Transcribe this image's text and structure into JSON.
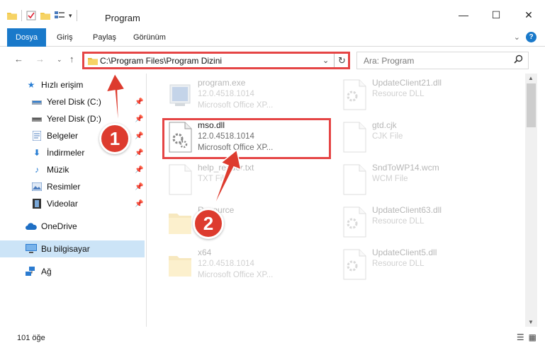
{
  "window": {
    "title": "Program"
  },
  "ribbon": {
    "tabs": [
      "Dosya",
      "Giriş",
      "Paylaş",
      "Görünüm"
    ],
    "help": "?"
  },
  "address": {
    "path": "C:\\Program Files\\Program Dizini"
  },
  "search": {
    "placeholder": "Ara: Program"
  },
  "sidebar": {
    "items": [
      {
        "label": "Hızlı erişim",
        "icon": "star-icon"
      },
      {
        "label": "Yerel Disk (C:)",
        "icon": "drive-icon"
      },
      {
        "label": "Yerel Disk (D:)",
        "icon": "drive-icon"
      },
      {
        "label": "Belgeler",
        "icon": "documents-icon"
      },
      {
        "label": "İndirmeler",
        "icon": "download-icon"
      },
      {
        "label": "Müzik",
        "icon": "music-icon"
      },
      {
        "label": "Resimler",
        "icon": "pictures-icon"
      },
      {
        "label": "Videolar",
        "icon": "video-icon"
      },
      {
        "label": "OneDrive",
        "icon": "cloud-icon"
      },
      {
        "label": "Bu bilgisayar",
        "icon": "computer-icon"
      },
      {
        "label": "Ağ",
        "icon": "network-icon"
      }
    ]
  },
  "files": [
    {
      "name": "program.exe",
      "line2": "12.0.4518.1014",
      "line3": "Microsoft Office XP..."
    },
    {
      "name": "mso.dll",
      "line2": "12.0.4518.1014",
      "line3": "Microsoft Office XP..."
    },
    {
      "name": "help_reader.txt",
      "line2": "TXT File",
      "line3": ""
    },
    {
      "name": "Resource",
      "line2": "",
      "line3": ""
    },
    {
      "name": "x64",
      "line2": "12.0.4518.1014",
      "line3": "Microsoft Office XP..."
    },
    {
      "name": "UpdateClient21.dll",
      "line2": "Resource DLL",
      "line3": ""
    },
    {
      "name": "gtd.cjk",
      "line2": "CJK File",
      "line3": ""
    },
    {
      "name": "SndToWP14.wcm",
      "line2": "WCM File",
      "line3": ""
    },
    {
      "name": "UpdateClient63.dll",
      "line2": "Resource DLL",
      "line3": ""
    },
    {
      "name": "UpdateClient5.dll",
      "line2": "Resource DLL",
      "line3": ""
    }
  ],
  "status": {
    "count": "101 öğe"
  },
  "callouts": [
    "1",
    "2"
  ],
  "colors": {
    "accent": "#1979ca",
    "callout": "#dd3b2e",
    "selection": "#cce4f7"
  }
}
